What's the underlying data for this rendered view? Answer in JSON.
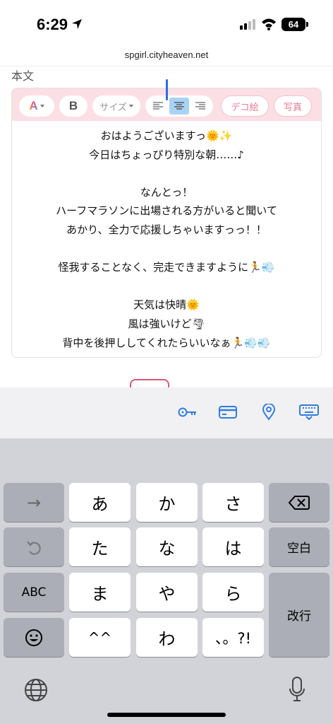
{
  "status": {
    "time": "6:29",
    "battery": "64"
  },
  "browser": {
    "url": "spgirl.cityheaven.net"
  },
  "section_label": "本文",
  "toolbar": {
    "color_label": "A",
    "bold_label": "B",
    "size_label": "サイズ",
    "deco_label": "デコ絵",
    "photo_label": "写真"
  },
  "body_lines": [
    "おはようございますっ🌞✨",
    "今日はちょっぴり特別な朝……♪",
    "",
    "なんとっ！",
    "ハーフマラソンに出場される方がいると聞いて",
    "あかり、全力で応援しちゃいますっっ！！",
    "",
    "怪我することなく、完走できますように🏃💨",
    "",
    "天気は快晴🌞",
    "風は強いけど🌪",
    "背中を後押ししてくれたらいいなぁ🏃💨💨"
  ],
  "keyboard": {
    "row1": [
      "→",
      "あ",
      "か",
      "さ"
    ],
    "row2": [
      "た",
      "な",
      "は"
    ],
    "row3_left": "ABC",
    "row3": [
      "ま",
      "や",
      "ら"
    ],
    "row4": [
      "^^",
      "わ",
      "、。?!"
    ],
    "space_label": "空白",
    "return_label": "改行"
  },
  "accent_color": "#2f7de1"
}
